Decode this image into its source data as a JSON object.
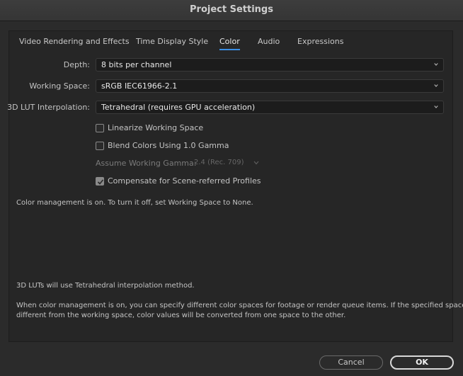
{
  "window": {
    "title": "Project Settings"
  },
  "tabs": [
    {
      "label": "Video Rendering and Effects",
      "active": false
    },
    {
      "label": "Time Display Style",
      "active": false
    },
    {
      "label": "Color",
      "active": true
    },
    {
      "label": "Audio",
      "active": false
    },
    {
      "label": "Expressions",
      "active": false
    }
  ],
  "settings": {
    "depth": {
      "label": "Depth:",
      "value": "8 bits per channel"
    },
    "working_space": {
      "label": "Working Space:",
      "value": "sRGB IEC61966-2.1"
    },
    "lut_interpolation": {
      "label": "3D LUT Interpolation:",
      "value": "Tetrahedral (requires GPU acceleration)"
    },
    "linearize": {
      "label": "Linearize Working Space",
      "checked": false
    },
    "blend_gamma": {
      "label": "Blend Colors Using 1.0 Gamma",
      "checked": false
    },
    "assume_gamma": {
      "label": "Assume Working Gamma:",
      "value": "2.4 (Rec. 709)",
      "enabled": false
    },
    "compensate": {
      "label": "Compensate for Scene-referred Profiles",
      "checked": true
    }
  },
  "info": {
    "status": "Color management is on. To turn it off, set Working Space to None.",
    "lut_note": "3D LUTs will use Tetrahedral interpolation method.",
    "detail_line1": "When color management is on, you can specify different color spaces for footage or render queue items. If the specified space is",
    "detail_line2": "different from the working space, color values will be converted from one space to the other."
  },
  "buttons": {
    "cancel": "Cancel",
    "ok": "OK"
  },
  "colors": {
    "accent": "#3a8ee6",
    "background": "#2b2b2b",
    "panel": "#262626"
  }
}
